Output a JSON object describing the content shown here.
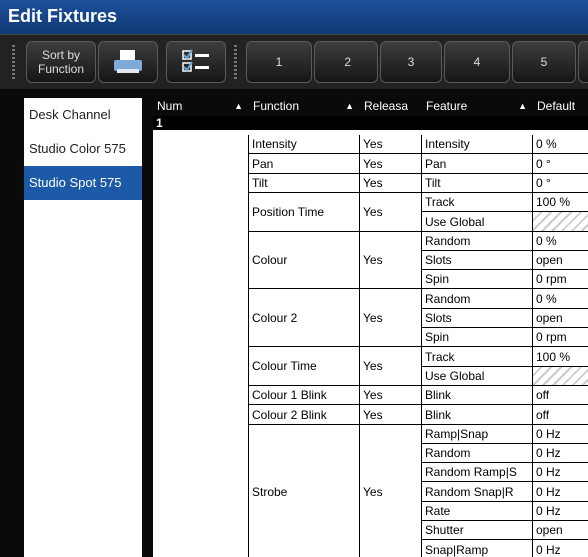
{
  "window": {
    "title": "Edit Fixtures"
  },
  "toolbar": {
    "sort_label": "Sort by\nFunction",
    "icons": [
      "print-icon",
      "checklist-icon"
    ],
    "numbered_buttons": [
      "1",
      "2",
      "3",
      "4",
      "5"
    ]
  },
  "sidebar": {
    "items": [
      {
        "label": "Desk Channel",
        "selected": false
      },
      {
        "label": "Studio Color 575",
        "selected": false
      },
      {
        "label": "Studio Spot 575",
        "selected": true
      }
    ]
  },
  "table": {
    "columns": [
      "Num",
      "Function",
      "Releasa",
      "Feature",
      "Default"
    ],
    "group_number": "1",
    "functions": [
      {
        "function": "Intensity",
        "release": "Yes",
        "features": [
          {
            "feature": "Intensity",
            "default": "0 %"
          }
        ]
      },
      {
        "function": "Pan",
        "release": "Yes",
        "features": [
          {
            "feature": "Pan",
            "default": "0 °"
          }
        ]
      },
      {
        "function": "Tilt",
        "release": "Yes",
        "features": [
          {
            "feature": "Tilt",
            "default": "0 °"
          }
        ]
      },
      {
        "function": "Position Time",
        "release": "Yes",
        "features": [
          {
            "feature": "Track",
            "default": "100 %"
          },
          {
            "feature": "Use Global",
            "default": ""
          }
        ]
      },
      {
        "function": "Colour",
        "release": "Yes",
        "features": [
          {
            "feature": "Random",
            "default": "0 %"
          },
          {
            "feature": "Slots",
            "default": "open"
          },
          {
            "feature": "Spin",
            "default": "0 rpm"
          }
        ]
      },
      {
        "function": "Colour 2",
        "release": "Yes",
        "features": [
          {
            "feature": "Random",
            "default": "0 %"
          },
          {
            "feature": "Slots",
            "default": "open"
          },
          {
            "feature": "Spin",
            "default": "0 rpm"
          }
        ]
      },
      {
        "function": "Colour Time",
        "release": "Yes",
        "features": [
          {
            "feature": "Track",
            "default": "100 %"
          },
          {
            "feature": "Use Global",
            "default": ""
          }
        ]
      },
      {
        "function": "Colour 1 Blink",
        "release": "Yes",
        "features": [
          {
            "feature": "Blink",
            "default": "off"
          }
        ]
      },
      {
        "function": "Colour 2 Blink",
        "release": "Yes",
        "features": [
          {
            "feature": "Blink",
            "default": "off"
          }
        ]
      },
      {
        "function": "Strobe",
        "release": "Yes",
        "features": [
          {
            "feature": "Ramp|Snap",
            "default": "0 Hz"
          },
          {
            "feature": "Random",
            "default": "0 Hz"
          },
          {
            "feature": "Random Ramp|S",
            "default": "0 Hz"
          },
          {
            "feature": "Random Snap|R",
            "default": "0 Hz"
          },
          {
            "feature": "Rate",
            "default": "0 Hz"
          },
          {
            "feature": "Shutter",
            "default": "open"
          },
          {
            "feature": "Snap|Ramp",
            "default": "0 Hz"
          }
        ]
      }
    ]
  },
  "colors": {
    "title_bar": "#1c4f9a",
    "selected_item": "#1c5aa8",
    "toolbar_bg": "#222222"
  }
}
